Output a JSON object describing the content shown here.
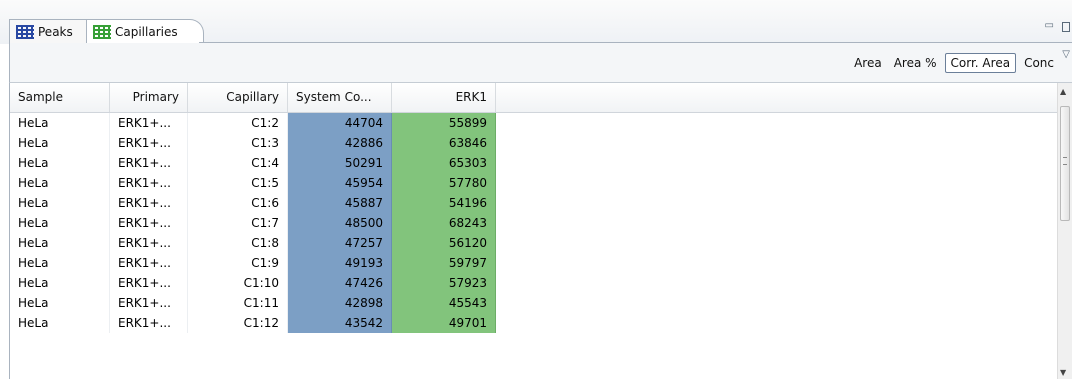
{
  "tabs": [
    {
      "label": "Peaks",
      "icon": "table-grid-icon"
    },
    {
      "label": "Capillaries",
      "icon": "table-grid-icon"
    }
  ],
  "window_controls": {
    "minimize": "minimize-icon",
    "maximize": "maximize-icon"
  },
  "modes": {
    "area": "Area",
    "area_pct": "Area %",
    "corr_area": "Corr. Area",
    "conc": "Conc",
    "selected": "Corr. Area"
  },
  "table": {
    "headers": [
      "Sample",
      "Primary",
      "Capillary",
      "System Co...",
      "ERK1"
    ],
    "rows": [
      [
        "HeLa",
        "ERK1+...",
        "C1:2",
        "44704",
        "55899"
      ],
      [
        "HeLa",
        "ERK1+...",
        "C1:3",
        "42886",
        "63846"
      ],
      [
        "HeLa",
        "ERK1+...",
        "C1:4",
        "50291",
        "65303"
      ],
      [
        "HeLa",
        "ERK1+...",
        "C1:5",
        "45954",
        "57780"
      ],
      [
        "HeLa",
        "ERK1+...",
        "C1:6",
        "45887",
        "54196"
      ],
      [
        "HeLa",
        "ERK1+...",
        "C1:7",
        "48500",
        "68243"
      ],
      [
        "HeLa",
        "ERK1+...",
        "C1:8",
        "47257",
        "56120"
      ],
      [
        "HeLa",
        "ERK1+...",
        "C1:9",
        "49193",
        "59797"
      ],
      [
        "HeLa",
        "ERK1+...",
        "C1:10",
        "47426",
        "57923"
      ],
      [
        "HeLa",
        "ERK1+...",
        "C1:11",
        "42898",
        "45543"
      ],
      [
        "HeLa",
        "ERK1+...",
        "C1:12",
        "43542",
        "49701"
      ]
    ]
  },
  "colors": {
    "system_control_column": "#7c9fc5",
    "erk1_column": "#82c47c"
  }
}
